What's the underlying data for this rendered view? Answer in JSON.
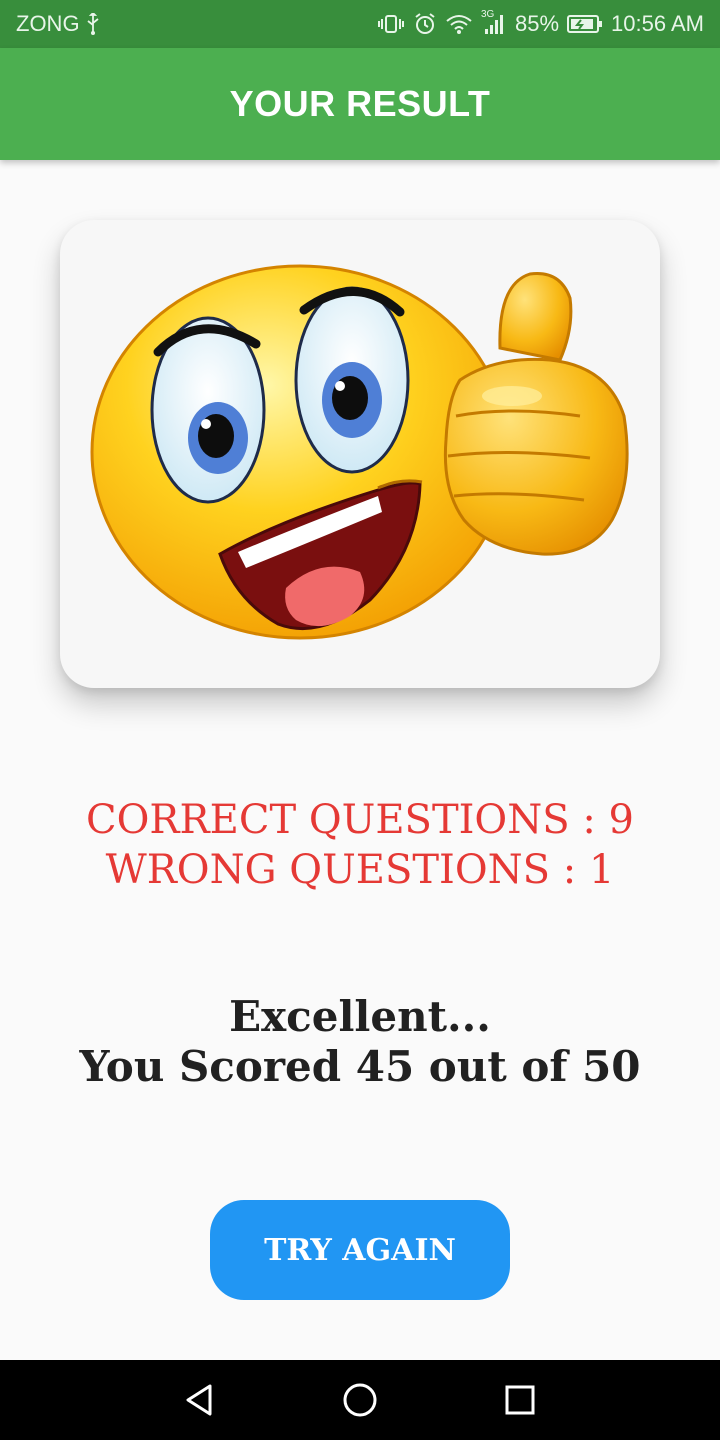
{
  "status_bar": {
    "carrier": "ZONG",
    "network": "3G",
    "battery": "85%",
    "time": "10:56 AM",
    "icons": [
      "usb-icon",
      "vibrate-icon",
      "alarm-icon",
      "wifi-icon",
      "signal-icon",
      "battery-icon"
    ]
  },
  "app_bar": {
    "title": "YOUR RESULT"
  },
  "result_image": {
    "icon": "thumbs-up-emoji-icon"
  },
  "stats": {
    "correct": "CORRECT QUESTIONS : 9",
    "wrong": "WRONG QUESTIONS : 1"
  },
  "message": {
    "line1": "Excellent...",
    "line2": "You Scored 45 out of 50"
  },
  "actions": {
    "try_again": "TRY AGAIN"
  },
  "navigation": {
    "icons": [
      "back-icon",
      "home-icon",
      "recents-icon"
    ]
  },
  "colors": {
    "status_bar": "#388e3c",
    "app_bar": "#4caf50",
    "stats_text": "#e53935",
    "button": "#2196f3",
    "nav_bar": "#000000"
  }
}
